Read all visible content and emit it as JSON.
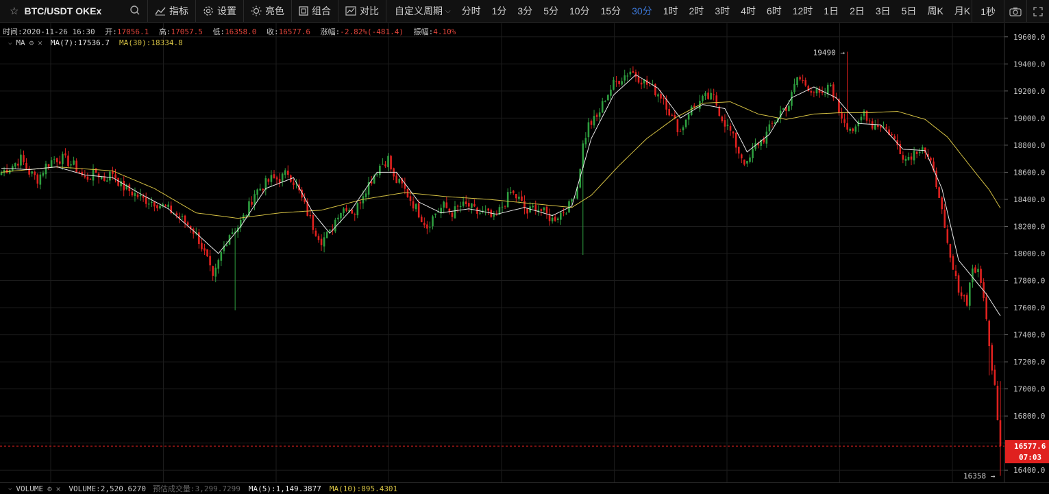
{
  "toolbar": {
    "symbol": "BTC/USDT OKEx",
    "buttons": {
      "indicators": "指标",
      "settings": "设置",
      "brightness": "亮色",
      "layout": "组合",
      "compare": "对比"
    },
    "period_menu": "自定义周期",
    "periods": [
      "分时",
      "1分",
      "3分",
      "5分",
      "10分",
      "15分",
      "30分",
      "1时",
      "2时",
      "3时",
      "4时",
      "6时",
      "12时",
      "1日",
      "2日",
      "3日",
      "5日",
      "周K",
      "月K"
    ],
    "active_period": "30分",
    "refresh": "1秒"
  },
  "info": {
    "time_label": "时间:",
    "time": "2020-11-26 16:30",
    "open_label": "开:",
    "open": "17056.1",
    "high_label": "高:",
    "high": "17057.5",
    "low_label": "低:",
    "low": "16358.0",
    "close_label": "收:",
    "close": "16577.6",
    "change_label": "涨幅:",
    "change": "-2.82%(-481.4)",
    "amp_label": "振幅:",
    "amp": "4.10%"
  },
  "legend": {
    "name": "MA",
    "ma7": "MA(7):17536.7",
    "ma30": "MA(30):18334.8"
  },
  "volume": {
    "name": "VOLUME",
    "volume": "VOLUME:2,520.6270",
    "est_label": "预估成交量:",
    "est": "3,299.7299",
    "ma5": "MA(5):1,149.3877",
    "ma10": "MA(10):895.4301"
  },
  "colors": {
    "up": "#2e9e3f",
    "down": "#e0211f",
    "ma7": "#e8e8e8",
    "ma30": "#d4c043",
    "grid": "#1c1c1c",
    "current_price_bg": "#e0211f"
  },
  "chart_data": {
    "type": "candlestick",
    "yticks": [
      16400,
      16600,
      16800,
      17000,
      17200,
      17400,
      17600,
      17800,
      18000,
      18200,
      18400,
      18600,
      18800,
      19000,
      19200,
      19400,
      19600
    ],
    "ylim": [
      16310,
      19700
    ],
    "current_price": "16577.6",
    "countdown": "07:03",
    "high_marker": {
      "value": 19490,
      "label": "19490"
    },
    "low_marker": {
      "value": 16358,
      "label": "16358"
    },
    "close_path": [
      [
        0,
        18600
      ],
      [
        4,
        18650
      ],
      [
        7,
        18700
      ],
      [
        10,
        18600
      ],
      [
        13,
        18550
      ],
      [
        16,
        18650
      ],
      [
        19,
        18700
      ],
      [
        22,
        18700
      ],
      [
        26,
        18650
      ],
      [
        30,
        18550
      ],
      [
        34,
        18600
      ],
      [
        37,
        18550
      ],
      [
        40,
        18600
      ],
      [
        43,
        18500
      ],
      [
        47,
        18450
      ],
      [
        51,
        18400
      ],
      [
        55,
        18380
      ],
      [
        58,
        18350
      ],
      [
        62,
        18300
      ],
      [
        65,
        18250
      ],
      [
        68,
        18200
      ],
      [
        71,
        18100
      ],
      [
        74,
        17950
      ],
      [
        76,
        17800
      ],
      [
        79,
        18000
      ],
      [
        82,
        18150
      ],
      [
        85,
        18200
      ],
      [
        88,
        18300
      ],
      [
        91,
        18450
      ],
      [
        94,
        18500
      ],
      [
        97,
        18550
      ],
      [
        100,
        18550
      ],
      [
        103,
        18600
      ],
      [
        106,
        18500
      ],
      [
        109,
        18350
      ],
      [
        112,
        18200
      ],
      [
        115,
        18100
      ],
      [
        118,
        18150
      ],
      [
        121,
        18300
      ],
      [
        124,
        18350
      ],
      [
        127,
        18300
      ],
      [
        130,
        18450
      ],
      [
        133,
        18550
      ],
      [
        136,
        18650
      ],
      [
        139,
        18700
      ],
      [
        141,
        18550
      ],
      [
        144,
        18500
      ],
      [
        147,
        18400
      ],
      [
        150,
        18300
      ],
      [
        153,
        18200
      ],
      [
        156,
        18300
      ],
      [
        159,
        18350
      ],
      [
        162,
        18300
      ],
      [
        165,
        18350
      ],
      [
        168,
        18350
      ],
      [
        171,
        18300
      ],
      [
        174,
        18300
      ],
      [
        177,
        18250
      ],
      [
        180,
        18350
      ],
      [
        183,
        18450
      ],
      [
        186,
        18400
      ],
      [
        189,
        18300
      ],
      [
        192,
        18350
      ],
      [
        195,
        18300
      ],
      [
        198,
        18250
      ],
      [
        201,
        18300
      ],
      [
        204,
        18350
      ],
      [
        207,
        18500
      ],
      [
        209,
        18800
      ],
      [
        211,
        18950
      ],
      [
        214,
        19000
      ],
      [
        217,
        19150
      ],
      [
        220,
        19250
      ],
      [
        223,
        19300
      ],
      [
        226,
        19350
      ],
      [
        229,
        19300
      ],
      [
        232,
        19250
      ],
      [
        235,
        19200
      ],
      [
        238,
        19150
      ],
      [
        241,
        19000
      ],
      [
        244,
        18900
      ],
      [
        247,
        19050
      ],
      [
        250,
        19100
      ],
      [
        253,
        19150
      ],
      [
        256,
        19150
      ],
      [
        259,
        19000
      ],
      [
        262,
        18900
      ],
      [
        265,
        18750
      ],
      [
        268,
        18650
      ],
      [
        271,
        18800
      ],
      [
        274,
        18850
      ],
      [
        277,
        18950
      ],
      [
        280,
        19050
      ],
      [
        283,
        19100
      ],
      [
        286,
        19300
      ],
      [
        289,
        19250
      ],
      [
        292,
        19200
      ],
      [
        295,
        19150
      ],
      [
        298,
        19250
      ],
      [
        301,
        19050
      ],
      [
        304,
        18950
      ],
      [
        307,
        18900
      ],
      [
        310,
        19050
      ],
      [
        313,
        18950
      ],
      [
        316,
        18950
      ],
      [
        319,
        18900
      ],
      [
        322,
        18800
      ],
      [
        325,
        18700
      ],
      [
        328,
        18750
      ],
      [
        331,
        18800
      ],
      [
        334,
        18650
      ],
      [
        337,
        18450
      ],
      [
        339,
        18150
      ],
      [
        341,
        17950
      ],
      [
        343,
        17800
      ],
      [
        345,
        17700
      ],
      [
        347,
        17650
      ],
      [
        349,
        17900
      ],
      [
        351,
        17850
      ],
      [
        353,
        17700
      ],
      [
        355,
        17300
      ],
      [
        357,
        17050
      ],
      [
        358,
        16800
      ],
      [
        359,
        16578
      ]
    ],
    "ma7": [
      [
        0,
        18630
      ],
      [
        10,
        18620
      ],
      [
        20,
        18640
      ],
      [
        30,
        18580
      ],
      [
        40,
        18560
      ],
      [
        50,
        18440
      ],
      [
        60,
        18330
      ],
      [
        70,
        18150
      ],
      [
        78,
        18000
      ],
      [
        86,
        18200
      ],
      [
        95,
        18480
      ],
      [
        105,
        18560
      ],
      [
        112,
        18300
      ],
      [
        118,
        18150
      ],
      [
        126,
        18330
      ],
      [
        135,
        18600
      ],
      [
        142,
        18600
      ],
      [
        150,
        18380
      ],
      [
        158,
        18300
      ],
      [
        168,
        18330
      ],
      [
        178,
        18290
      ],
      [
        188,
        18340
      ],
      [
        198,
        18280
      ],
      [
        205,
        18350
      ],
      [
        212,
        18850
      ],
      [
        220,
        19170
      ],
      [
        228,
        19320
      ],
      [
        236,
        19220
      ],
      [
        244,
        19000
      ],
      [
        252,
        19100
      ],
      [
        260,
        19070
      ],
      [
        268,
        18750
      ],
      [
        276,
        18880
      ],
      [
        284,
        19150
      ],
      [
        292,
        19230
      ],
      [
        300,
        19150
      ],
      [
        308,
        18960
      ],
      [
        316,
        18950
      ],
      [
        324,
        18770
      ],
      [
        332,
        18760
      ],
      [
        338,
        18480
      ],
      [
        344,
        17950
      ],
      [
        350,
        17800
      ],
      [
        354,
        17700
      ],
      [
        359,
        17540
      ]
    ],
    "ma30": [
      [
        0,
        18600
      ],
      [
        20,
        18640
      ],
      [
        40,
        18610
      ],
      [
        55,
        18480
      ],
      [
        70,
        18300
      ],
      [
        85,
        18260
      ],
      [
        100,
        18300
      ],
      [
        115,
        18320
      ],
      [
        130,
        18400
      ],
      [
        145,
        18450
      ],
      [
        160,
        18420
      ],
      [
        175,
        18400
      ],
      [
        190,
        18370
      ],
      [
        205,
        18340
      ],
      [
        212,
        18430
      ],
      [
        222,
        18650
      ],
      [
        232,
        18850
      ],
      [
        242,
        19000
      ],
      [
        252,
        19110
      ],
      [
        262,
        19120
      ],
      [
        272,
        19030
      ],
      [
        282,
        18990
      ],
      [
        292,
        19030
      ],
      [
        302,
        19040
      ],
      [
        312,
        19040
      ],
      [
        322,
        19050
      ],
      [
        332,
        18990
      ],
      [
        340,
        18860
      ],
      [
        348,
        18650
      ],
      [
        355,
        18470
      ],
      [
        359,
        18335
      ]
    ]
  }
}
